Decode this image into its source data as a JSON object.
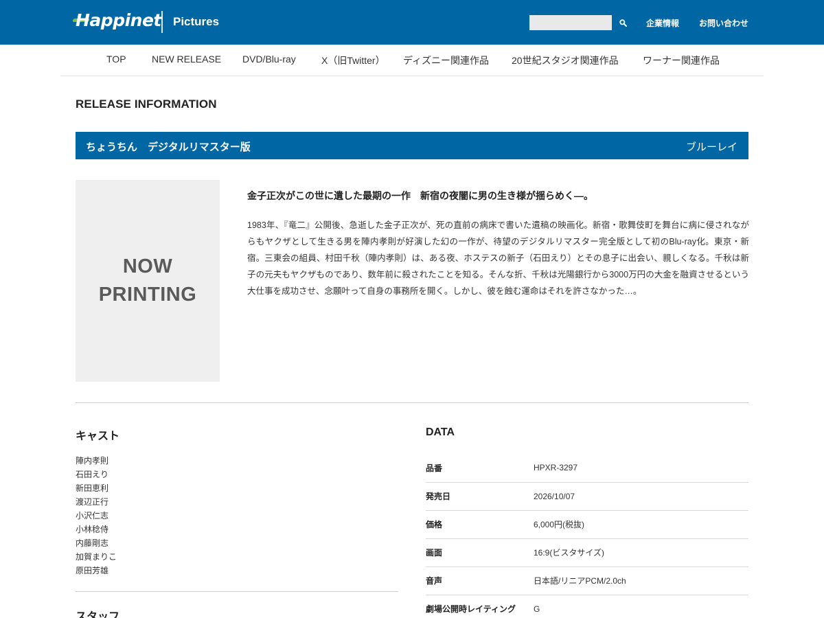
{
  "header": {
    "logo_text": "Happinet",
    "brand_sub": "Pictures",
    "search": {
      "value": "",
      "placeholder": ""
    },
    "search_icon": "search-icon",
    "links": {
      "company": "企業情報",
      "contact": "お問い合わせ"
    }
  },
  "nav": {
    "items": [
      "TOP",
      "NEW RELEASE",
      "DVD/Blu-ray",
      "X（旧Twitter）",
      "ディズニー関連作品",
      "20世紀スタジオ関連作品",
      "ワーナー関連作品"
    ]
  },
  "release": {
    "heading": "RELEASE INFORMATION",
    "title": "ちょうちん　デジタルリマスター版",
    "format": "ブルーレイ",
    "jacket": {
      "line1": "NOW",
      "line2": "PRINTING"
    },
    "catchcopy": "金子正次がこの世に遺した最期の一作　新宿の夜闇に男の生き様が揺らめく―。",
    "synopsis": "1983年、『竜二』公開後、急逝した金子正次が、死の直前の病床で書いた遺稿の映画化。新宿・歌舞伎町を舞台に病に侵されながらもヤクザとして生きる男を陣内孝則が好演した幻の一作が、待望のデジタルリマスター完全版として初のBlu-ray化。東京・新宿。三東会の組員、村田千秋（陣内孝則）は、ある夜、ホステスの新子（石田えり）とその息子に出会い、親しくなる。千秋は新子の元夫もヤクザものであり、数年前に殺されたことを知る。そんな折、千秋は光陽銀行から3000万円の大金を融資させるという大仕事を成功させ、念願叶って自身の事務所を開く。しかし、彼を蝕む運命はそれを許さなかった…。"
  },
  "cast": {
    "heading": "キャスト",
    "members": [
      "陣内孝則",
      "石田えり",
      "新田恵利",
      "渡辺正行",
      "小沢仁志",
      "小林稔侍",
      "内藤剛志",
      "加賀まりこ",
      "原田芳雄"
    ]
  },
  "staff": {
    "heading": "スタッフ"
  },
  "data": {
    "heading": "DATA",
    "rows": [
      {
        "label": "品番",
        "value": "HPXR-3297"
      },
      {
        "label": "発売日",
        "value": "2026/10/07"
      },
      {
        "label": "価格",
        "value": "6,000円(税抜)"
      },
      {
        "label": "画面",
        "value": "16:9(ビスタサイズ)"
      },
      {
        "label": "音声",
        "value": "日本語/リニアPCM/2.0ch"
      },
      {
        "label": "劇場公開時レイティング",
        "value": "G"
      }
    ]
  },
  "colors": {
    "brand_blue": "#0066a4",
    "logo_green": "#7cc242",
    "placeholder_bg": "#efefef"
  }
}
